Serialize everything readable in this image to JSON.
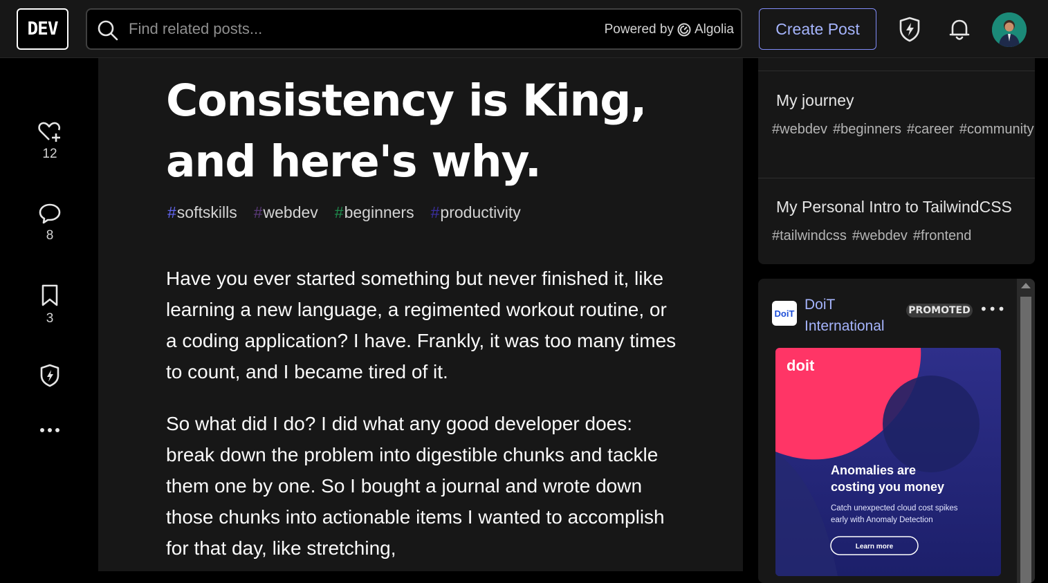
{
  "header": {
    "logo": "DEV",
    "search_placeholder": "Find related posts...",
    "powered_by": "Powered by",
    "algolia": "Algolia",
    "create_post": "Create Post"
  },
  "rail": {
    "reactions": "12",
    "comments": "8",
    "bookmarks": "3"
  },
  "article": {
    "title": "Consistency is King, and here's why.",
    "tags": [
      {
        "name": "softskills",
        "hash_color": "#6366f1"
      },
      {
        "name": "webdev",
        "hash_color": "#5b3a7a"
      },
      {
        "name": "beginners",
        "hash_color": "#1f8a4c"
      },
      {
        "name": "productivity",
        "hash_color": "#3b2fa0"
      }
    ],
    "paragraphs": [
      "Have you ever started something but never finished it, like learning a new language, a regimented workout routine, or a coding application? I have. Frankly, it was too many times to count, and I became tired of it.",
      "So what did I do? I did what any good developer does: break down the problem into digestible chunks and tackle them one by one. So I bought a journal and wrote down those chunks into actionable items I wanted to accomplish for that day, like stretching,"
    ]
  },
  "sidebar": {
    "posts": [
      {
        "title": "My journey",
        "tags": [
          "webdev",
          "beginners",
          "career",
          "community"
        ]
      },
      {
        "title": "My Personal Intro to TailwindCSS",
        "tags": [
          "tailwindcss",
          "webdev",
          "frontend"
        ]
      }
    ],
    "ad": {
      "logo_text": "DoiT",
      "sponsor": "DoiT International",
      "badge": "PROMOTED",
      "more": "•••",
      "banner_brand": "doit",
      "banner_headline": "Anomalies are costing you money",
      "banner_sub": "Catch unexpected cloud cost spikes early with Anomaly Detection",
      "banner_cta": "Learn more"
    }
  },
  "colors": {
    "accent": "#818cf8",
    "background": "#171717",
    "page": "#000000"
  }
}
